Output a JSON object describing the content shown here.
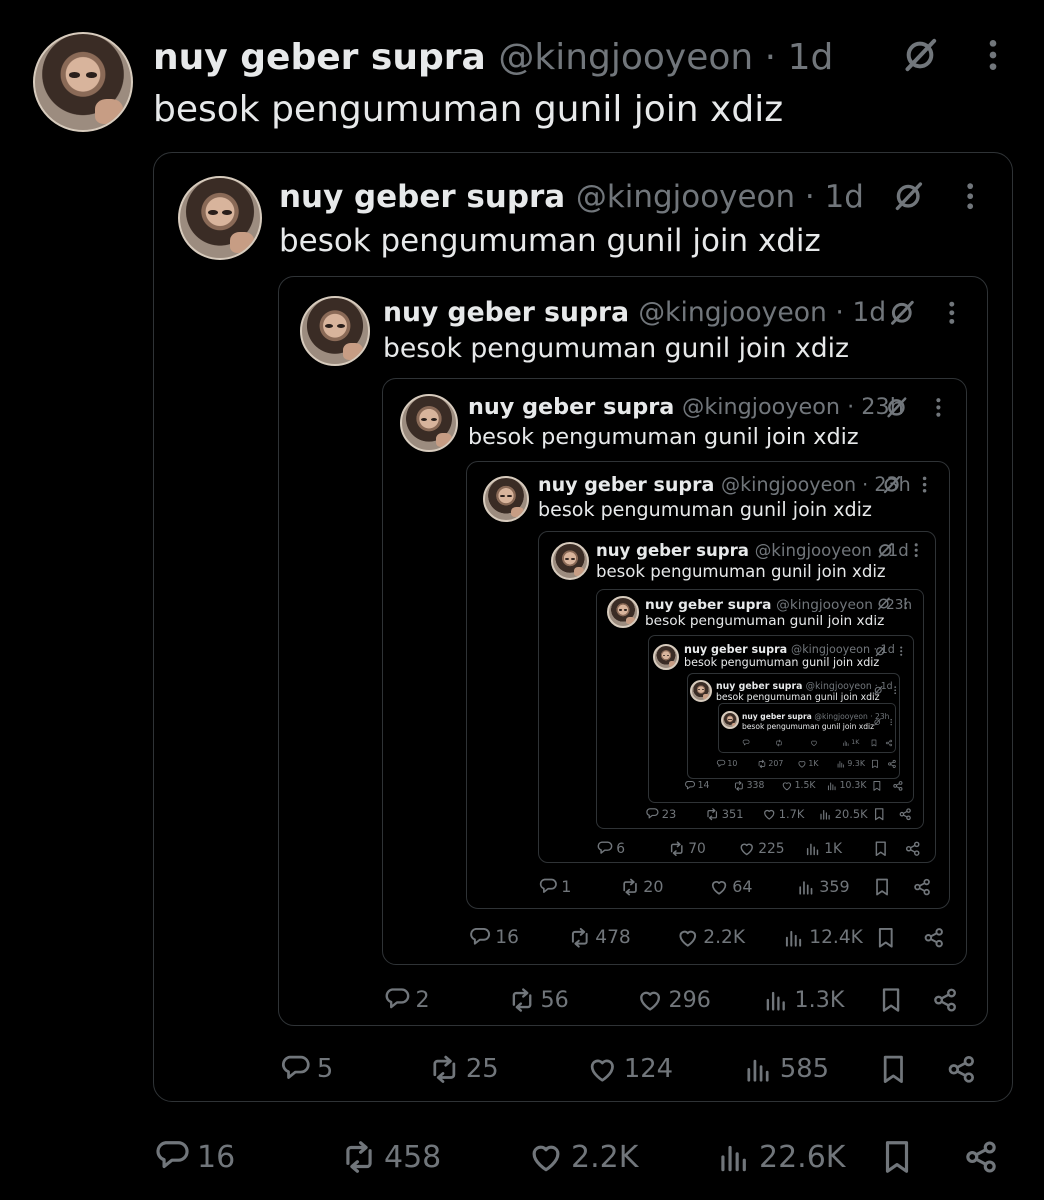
{
  "colors": {
    "background": "#000000",
    "border": "#2f3336",
    "text": "#e7e9ea",
    "muted": "#71767b"
  },
  "tweets": [
    {
      "name": "nuy geber supra",
      "handle": "@kingjooyeon",
      "time": "1d",
      "text": "besok pengumuman gunil join xdiz",
      "stats": {
        "replies": "16",
        "reposts": "458",
        "likes": "2.2K",
        "views": "22.6K"
      }
    },
    {
      "name": "nuy geber supra",
      "handle": "@kingjooyeon",
      "time": "1d",
      "text": "besok pengumuman gunil join xdiz",
      "stats": {
        "replies": "5",
        "reposts": "25",
        "likes": "124",
        "views": "585"
      }
    },
    {
      "name": "nuy geber supra",
      "handle": "@kingjooyeon",
      "time": "1d",
      "text": "besok pengumuman gunil join xdiz",
      "stats": {
        "replies": "2",
        "reposts": "56",
        "likes": "296",
        "views": "1.3K"
      }
    },
    {
      "name": "nuy geber supra",
      "handle": "@kingjooyeon",
      "time": "23h",
      "text": "besok pengumuman gunil join xdiz",
      "stats": {
        "replies": "16",
        "reposts": "478",
        "likes": "2.2K",
        "views": "12.4K"
      }
    },
    {
      "name": "nuy geber supra",
      "handle": "@kingjooyeon",
      "time": "23h",
      "text": "besok pengumuman gunil join xdiz",
      "stats": {
        "replies": "1",
        "reposts": "20",
        "likes": "64",
        "views": "359"
      }
    },
    {
      "name": "nuy geber supra",
      "handle": "@kingjooyeon",
      "time": "1d",
      "text": "besok pengumuman gunil join xdiz",
      "stats": {
        "replies": "6",
        "reposts": "70",
        "likes": "225",
        "views": "1K"
      }
    },
    {
      "name": "nuy geber supra",
      "handle": "@kingjooyeon",
      "time": "23h",
      "text": "besok pengumuman gunil join xdiz",
      "stats": {
        "replies": "23",
        "reposts": "351",
        "likes": "1.7K",
        "views": "20.5K"
      }
    },
    {
      "name": "nuy geber supra",
      "handle": "@kingjooyeon",
      "time": "1d",
      "text": "besok pengumuman gunil join xdiz",
      "stats": {
        "replies": "14",
        "reposts": "338",
        "likes": "1.5K",
        "views": "10.3K"
      }
    },
    {
      "name": "nuy geber supra",
      "handle": "@kingjooyeon",
      "time": "1d",
      "text": "besok pengumuman gunil join xdiz",
      "stats": {
        "replies": "10",
        "reposts": "207",
        "likes": "1K",
        "views": "9.3K"
      }
    },
    {
      "name": "nuy geber supra",
      "handle": "@kingjooyeon",
      "time": "23h",
      "text": "besok pengumuman gunil join xdiz",
      "stats": {
        "replies": "",
        "reposts": "",
        "likes": "",
        "views": "1K"
      }
    }
  ]
}
